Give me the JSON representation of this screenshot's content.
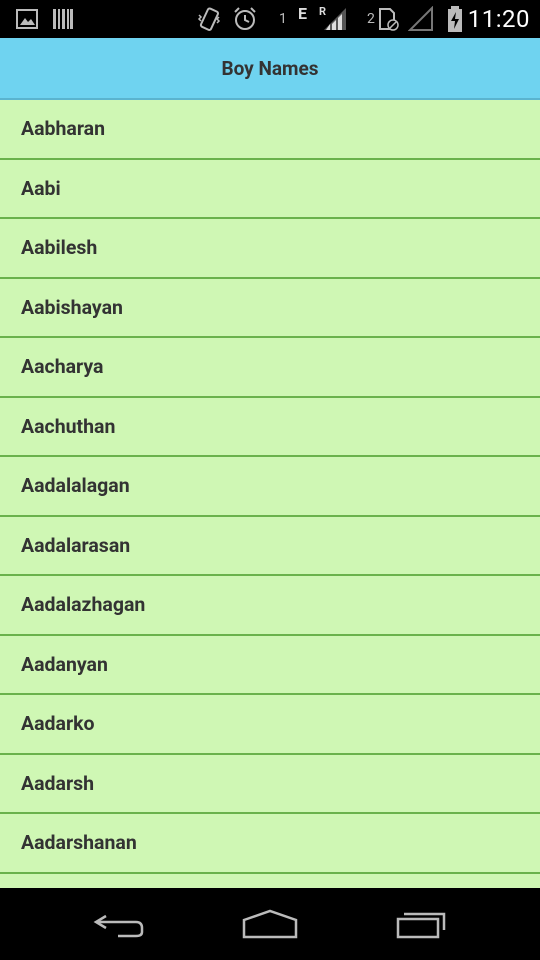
{
  "status_bar": {
    "time": "11:20",
    "sim1_label": "1",
    "sim1_network": "E",
    "sim1_roaming": "R",
    "sim2_label": "2",
    "icons": [
      "image-icon",
      "barcode-icon",
      "vibrate-icon",
      "alarm-icon",
      "signal-icon",
      "sim2-icon",
      "signal-empty-icon",
      "battery-charging-icon"
    ]
  },
  "header": {
    "title": "Boy Names"
  },
  "names": [
    {
      "label": "Aabharan"
    },
    {
      "label": "Aabi"
    },
    {
      "label": "Aabilesh"
    },
    {
      "label": "Aabishayan"
    },
    {
      "label": "Aacharya"
    },
    {
      "label": "Aachuthan"
    },
    {
      "label": "Aadalalagan"
    },
    {
      "label": "Aadalarasan"
    },
    {
      "label": "Aadalazhagan"
    },
    {
      "label": "Aadanyan"
    },
    {
      "label": "Aadarko"
    },
    {
      "label": "Aadarsh"
    },
    {
      "label": "Aadarshanan"
    },
    {
      "label": ""
    }
  ],
  "nav_bar": {
    "icons": [
      "back-icon",
      "home-icon",
      "recents-icon"
    ]
  }
}
